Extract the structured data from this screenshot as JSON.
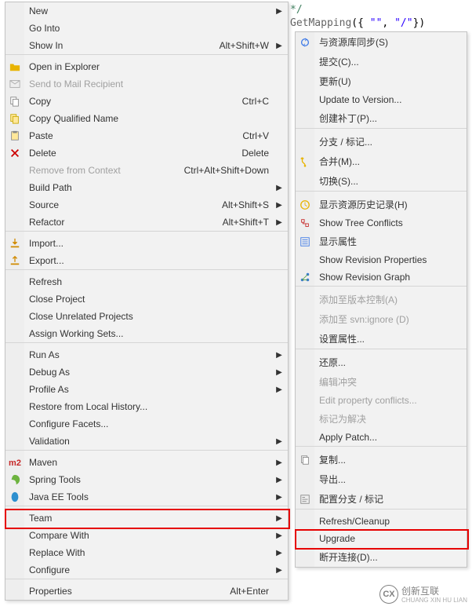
{
  "code": {
    "comment_end": "*/",
    "annotation": "GetMapping",
    "args_open": "({ ",
    "str1": "\"\"",
    "comma": ", ",
    "str2": "\"/\"",
    "args_close": "})"
  },
  "main_menu": [
    {
      "label": "New",
      "accel": "",
      "arrow": true,
      "icon": ""
    },
    {
      "label": "Go Into",
      "accel": "",
      "arrow": false,
      "icon": ""
    },
    {
      "label": "Show In",
      "accel": "Alt+Shift+W",
      "arrow": true,
      "icon": ""
    },
    {
      "sep": true
    },
    {
      "label": "Open in Explorer",
      "accel": "",
      "arrow": false,
      "icon": "folder"
    },
    {
      "label": "Send to Mail Recipient",
      "accel": "",
      "arrow": false,
      "icon": "mail",
      "disabled": true
    },
    {
      "label": "Copy",
      "accel": "Ctrl+C",
      "arrow": false,
      "icon": "copy"
    },
    {
      "label": "Copy Qualified Name",
      "accel": "",
      "arrow": false,
      "icon": "copyq"
    },
    {
      "label": "Paste",
      "accel": "Ctrl+V",
      "arrow": false,
      "icon": "paste"
    },
    {
      "label": "Delete",
      "accel": "Delete",
      "arrow": false,
      "icon": "delete"
    },
    {
      "label": "Remove from Context",
      "accel": "Ctrl+Alt+Shift+Down",
      "arrow": false,
      "icon": "",
      "disabled": true
    },
    {
      "label": "Build Path",
      "accel": "",
      "arrow": true,
      "icon": ""
    },
    {
      "label": "Source",
      "accel": "Alt+Shift+S",
      "arrow": true,
      "icon": ""
    },
    {
      "label": "Refactor",
      "accel": "Alt+Shift+T",
      "arrow": true,
      "icon": ""
    },
    {
      "sep": true
    },
    {
      "label": "Import...",
      "accel": "",
      "arrow": false,
      "icon": "import"
    },
    {
      "label": "Export...",
      "accel": "",
      "arrow": false,
      "icon": "export"
    },
    {
      "sep": true
    },
    {
      "label": "Refresh",
      "accel": "",
      "arrow": false,
      "icon": ""
    },
    {
      "label": "Close Project",
      "accel": "",
      "arrow": false,
      "icon": ""
    },
    {
      "label": "Close Unrelated Projects",
      "accel": "",
      "arrow": false,
      "icon": ""
    },
    {
      "label": "Assign Working Sets...",
      "accel": "",
      "arrow": false,
      "icon": ""
    },
    {
      "sep": true
    },
    {
      "label": "Run As",
      "accel": "",
      "arrow": true,
      "icon": ""
    },
    {
      "label": "Debug As",
      "accel": "",
      "arrow": true,
      "icon": ""
    },
    {
      "label": "Profile As",
      "accel": "",
      "arrow": true,
      "icon": ""
    },
    {
      "label": "Restore from Local History...",
      "accel": "",
      "arrow": false,
      "icon": ""
    },
    {
      "label": "Configure Facets...",
      "accel": "",
      "arrow": false,
      "icon": ""
    },
    {
      "label": "Validation",
      "accel": "",
      "arrow": true,
      "icon": ""
    },
    {
      "sep": true
    },
    {
      "label": "Maven",
      "accel": "",
      "arrow": true,
      "icon": "m2"
    },
    {
      "label": "Spring Tools",
      "accel": "",
      "arrow": true,
      "icon": "spring"
    },
    {
      "label": "Java EE Tools",
      "accel": "",
      "arrow": true,
      "icon": "bean"
    },
    {
      "sep": true
    },
    {
      "label": "Team",
      "accel": "",
      "arrow": true,
      "icon": "",
      "highlighted": true,
      "id": "team"
    },
    {
      "label": "Compare With",
      "accel": "",
      "arrow": true,
      "icon": ""
    },
    {
      "label": "Replace With",
      "accel": "",
      "arrow": true,
      "icon": ""
    },
    {
      "label": "Configure",
      "accel": "",
      "arrow": true,
      "icon": ""
    },
    {
      "sep": true
    },
    {
      "label": "Properties",
      "accel": "Alt+Enter",
      "arrow": false,
      "icon": ""
    }
  ],
  "sub_menu": [
    {
      "label": "与资源库同步(S)",
      "icon": "sync"
    },
    {
      "label": "提交(C)...",
      "icon": ""
    },
    {
      "label": "更新(U)",
      "icon": ""
    },
    {
      "label": "Update to Version...",
      "icon": ""
    },
    {
      "label": "创建补丁(P)...",
      "icon": ""
    },
    {
      "sep": true
    },
    {
      "label": "分支 / 标记...",
      "icon": ""
    },
    {
      "label": "合并(M)...",
      "icon": "merge"
    },
    {
      "label": "切换(S)...",
      "icon": ""
    },
    {
      "sep": true
    },
    {
      "label": "显示资源历史记录(H)",
      "icon": "history"
    },
    {
      "label": "Show Tree Conflicts",
      "icon": "tree"
    },
    {
      "label": "显示属性",
      "icon": "props"
    },
    {
      "label": "Show Revision Properties",
      "icon": ""
    },
    {
      "label": "Show Revision Graph",
      "icon": "graph"
    },
    {
      "sep": true
    },
    {
      "label": "添加至版本控制(A)",
      "icon": "",
      "disabled": true
    },
    {
      "label": "添加至 svn:ignore (D)",
      "icon": "",
      "disabled": true
    },
    {
      "label": "设置属性...",
      "icon": ""
    },
    {
      "sep": true
    },
    {
      "label": "还原...",
      "icon": ""
    },
    {
      "label": "编辑冲突",
      "icon": "",
      "disabled": true
    },
    {
      "label": "Edit property conflicts...",
      "icon": "",
      "disabled": true
    },
    {
      "label": "标记为解决",
      "icon": "",
      "disabled": true
    },
    {
      "label": "Apply Patch...",
      "icon": ""
    },
    {
      "sep": true
    },
    {
      "label": "复制...",
      "icon": "copyfile"
    },
    {
      "label": "导出...",
      "icon": ""
    },
    {
      "label": "配置分支 / 标记",
      "icon": "cfg"
    },
    {
      "sep": true
    },
    {
      "label": "Refresh/Cleanup",
      "icon": ""
    },
    {
      "label": "Upgrade",
      "icon": "",
      "highlighted": true,
      "id": "upgrade"
    },
    {
      "label": "断开连接(D)...",
      "icon": ""
    }
  ],
  "watermark": {
    "brand_cn": "创新互联",
    "brand_en": "CHUANG XIN HU LIAN",
    "logo": "CX"
  }
}
